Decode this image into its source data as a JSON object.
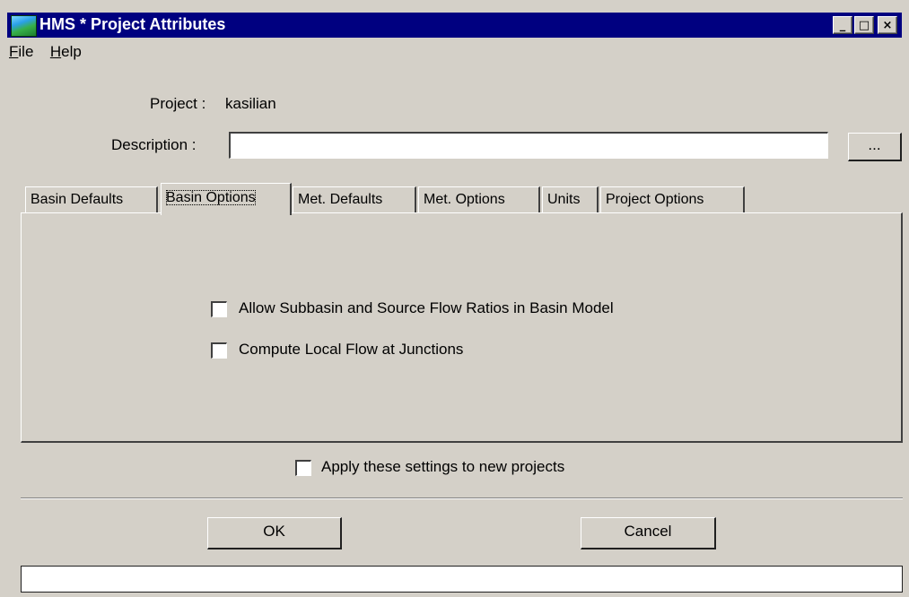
{
  "window": {
    "title": "HMS * Project Attributes",
    "icon": "hms-app-icon",
    "controls": {
      "minimize": "_",
      "maximize": "□",
      "close": "×"
    }
  },
  "menu": {
    "file": "File",
    "help": "Help"
  },
  "form": {
    "project_label": "Project :",
    "project_value": "kasilian",
    "description_label": "Description :",
    "description_value": "",
    "browse_label": "..."
  },
  "tabs": [
    {
      "label": "Basin Defaults",
      "active": false
    },
    {
      "label": "Basin Options",
      "active": true
    },
    {
      "label": "Met. Defaults",
      "active": false
    },
    {
      "label": "Met. Options",
      "active": false
    },
    {
      "label": "Units",
      "active": false
    },
    {
      "label": "Project Options",
      "active": false
    }
  ],
  "basin_options": {
    "allow_ratios": {
      "label": "Allow Subbasin and Source Flow Ratios in Basin Model",
      "checked": false
    },
    "local_flow": {
      "label": "Compute Local Flow at Junctions",
      "checked": false
    }
  },
  "apply_new": {
    "label": "Apply these settings to new projects",
    "checked": false
  },
  "buttons": {
    "ok": "OK",
    "cancel": "Cancel"
  },
  "status": {
    "text": ""
  },
  "colors": {
    "titlebar": "#000080",
    "face": "#d4d0c8"
  }
}
